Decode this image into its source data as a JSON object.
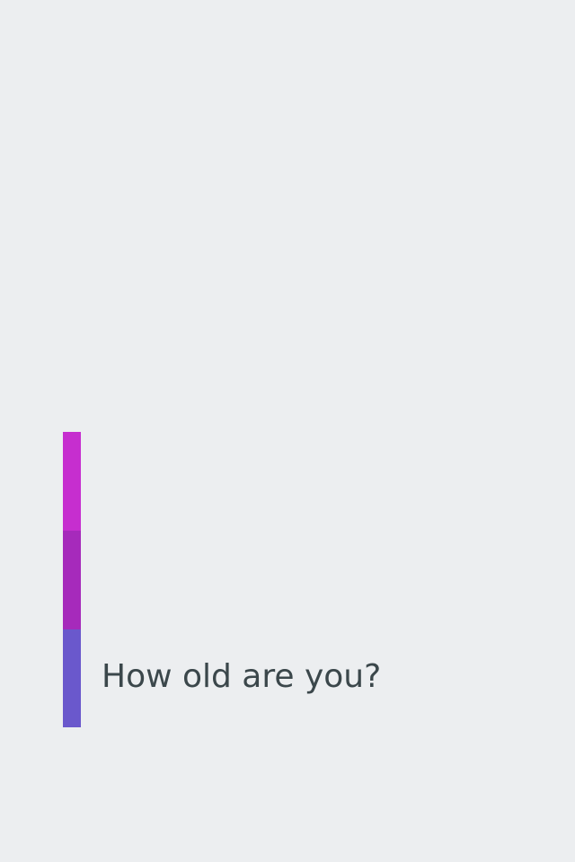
{
  "question": {
    "text": "How old are you?"
  },
  "accent_bar": {
    "segments": [
      {
        "name": "top",
        "color": "#c62ecf"
      },
      {
        "name": "middle",
        "color": "#a62abb"
      },
      {
        "name": "bottom",
        "color": "#6a58cc"
      }
    ]
  },
  "colors": {
    "background": "#eceef0",
    "text": "#3b474b"
  }
}
